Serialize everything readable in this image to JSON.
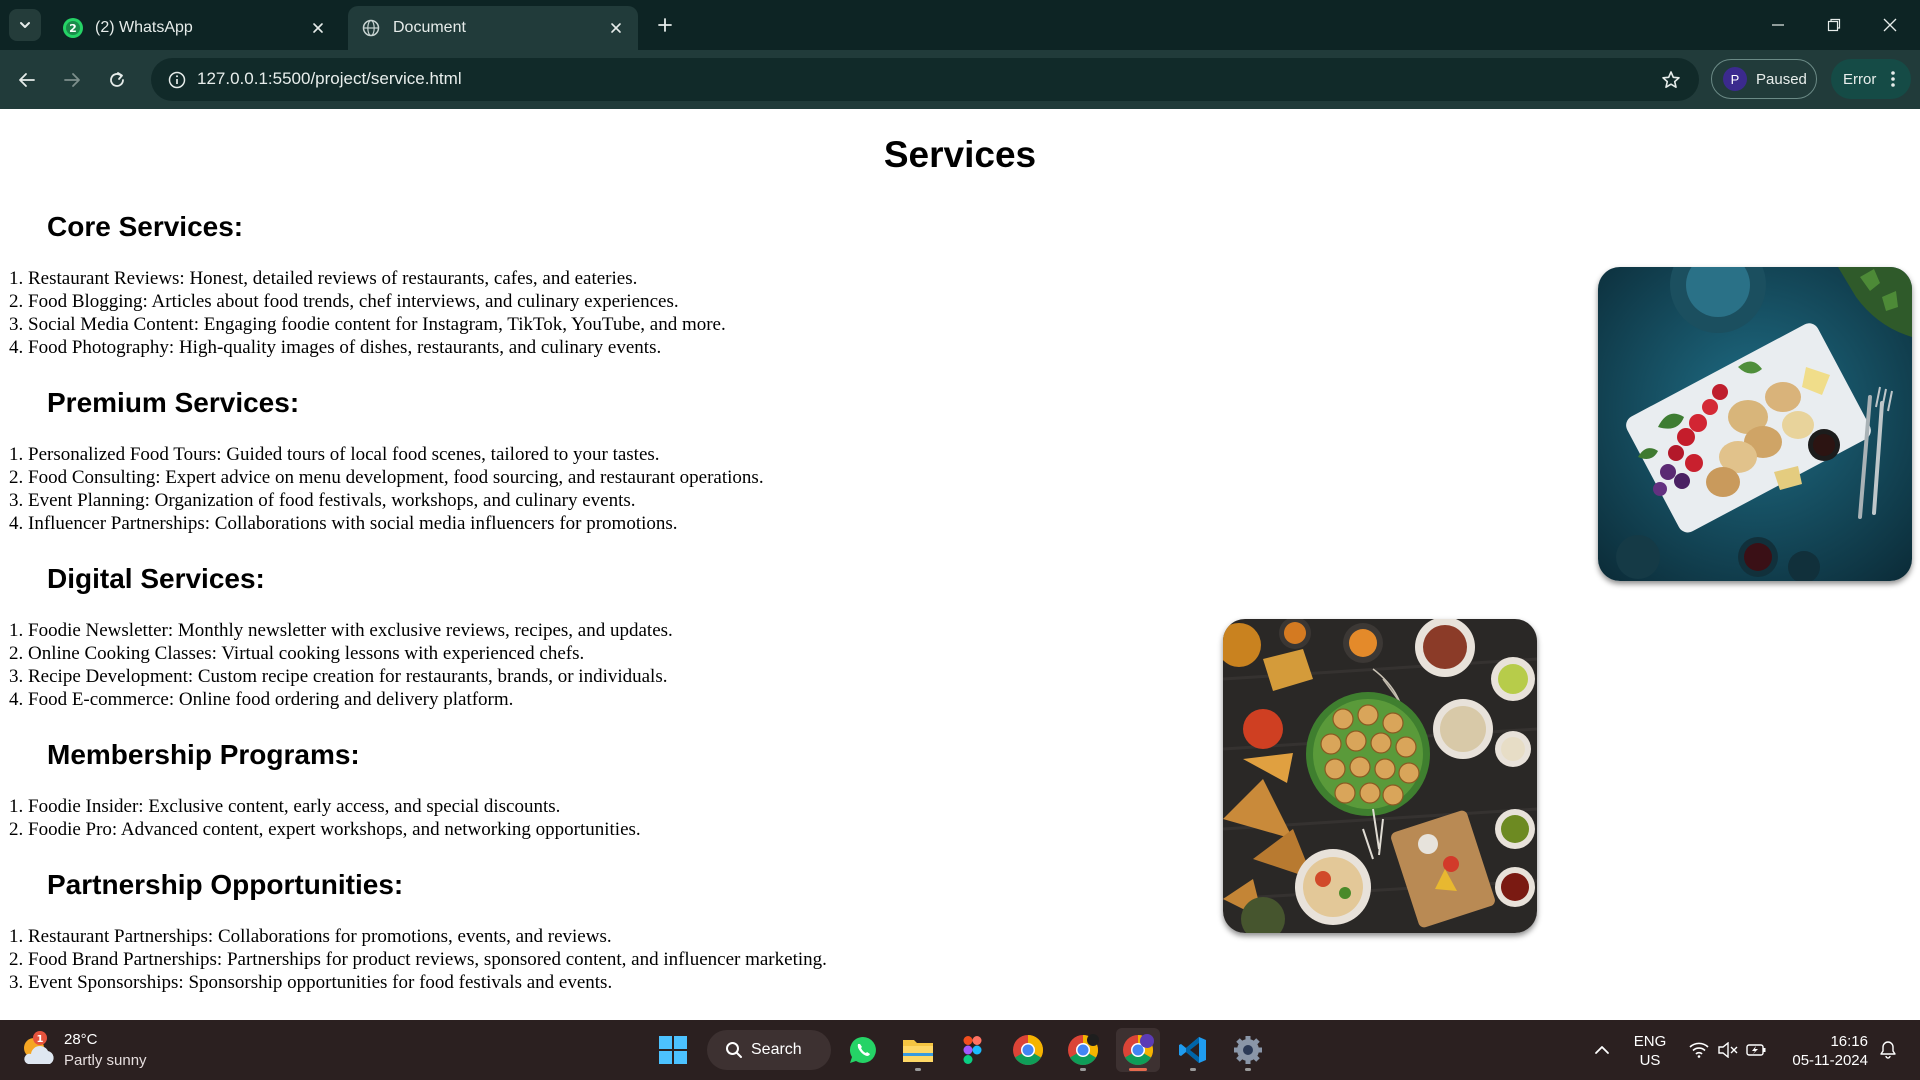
{
  "browser": {
    "tabs": [
      {
        "title": "(2) WhatsApp",
        "badge": "2",
        "icon": "whatsapp-icon"
      },
      {
        "title": "Document",
        "icon": "globe-icon"
      }
    ],
    "url": "127.0.0.1:5500/project/service.html",
    "profile_initial": "P",
    "profile_status": "Paused",
    "error_label": "Error",
    "colors": {
      "frame": "#0d2424",
      "toolbar": "#213b3a",
      "omnibox": "#112a29"
    }
  },
  "page": {
    "title": "Services",
    "sections": [
      {
        "heading": "Core Services:",
        "items": [
          "1. Restaurant Reviews: Honest, detailed reviews of restaurants, cafes, and eateries.",
          "2. Food Blogging: Articles about food trends, chef interviews, and culinary experiences.",
          "3. Social Media Content: Engaging foodie content for Instagram, TikTok, YouTube, and more.",
          "4. Food Photography: High-quality images of dishes, restaurants, and culinary events."
        ]
      },
      {
        "heading": "Premium Services:",
        "items": [
          "1. Personalized Food Tours: Guided tours of local food scenes, tailored to your tastes.",
          "2. Food Consulting: Expert advice on menu development, food sourcing, and restaurant operations.",
          "3. Event Planning: Organization of food festivals, workshops, and culinary events.",
          "4. Influencer Partnerships: Collaborations with social media influencers for promotions."
        ]
      },
      {
        "heading": "Digital Services:",
        "items": [
          "1. Foodie Newsletter: Monthly newsletter with exclusive reviews, recipes, and updates.",
          "2. Online Cooking Classes: Virtual cooking lessons with experienced chefs.",
          "3. Recipe Development: Custom recipe creation for restaurants, brands, or individuals.",
          "4. Food E-commerce: Online food ordering and delivery platform."
        ]
      },
      {
        "heading": "Membership Programs:",
        "items": [
          "1. Foodie Insider: Exclusive content, early access, and special discounts.",
          "2. Foodie Pro: Advanced content, expert workshops, and networking opportunities."
        ]
      },
      {
        "heading": "Partnership Opportunities:",
        "items": [
          "1. Restaurant Partnerships: Collaborations for promotions, events, and reviews.",
          "2. Food Brand Partnerships: Partnerships for product reviews, sponsored content, and influencer marketing.",
          "3. Event Sponsorships: Sponsorship opportunities for food festivals and events."
        ]
      }
    ],
    "images": [
      "snack-platter-photo",
      "street-food-spread-photo"
    ]
  },
  "taskbar": {
    "weather": {
      "badge": "1",
      "temp": "28°C",
      "condition": "Partly sunny"
    },
    "search_label": "Search",
    "apps": [
      "windows-start-icon",
      "whatsapp-icon",
      "file-explorer-icon",
      "figma-icon",
      "chrome-icon",
      "chrome-profile-icon",
      "chrome-active-icon",
      "vscode-icon",
      "settings-icon"
    ],
    "language": {
      "line1": "ENG",
      "line2": "US"
    },
    "time": "16:16",
    "date": "05-11-2024"
  }
}
